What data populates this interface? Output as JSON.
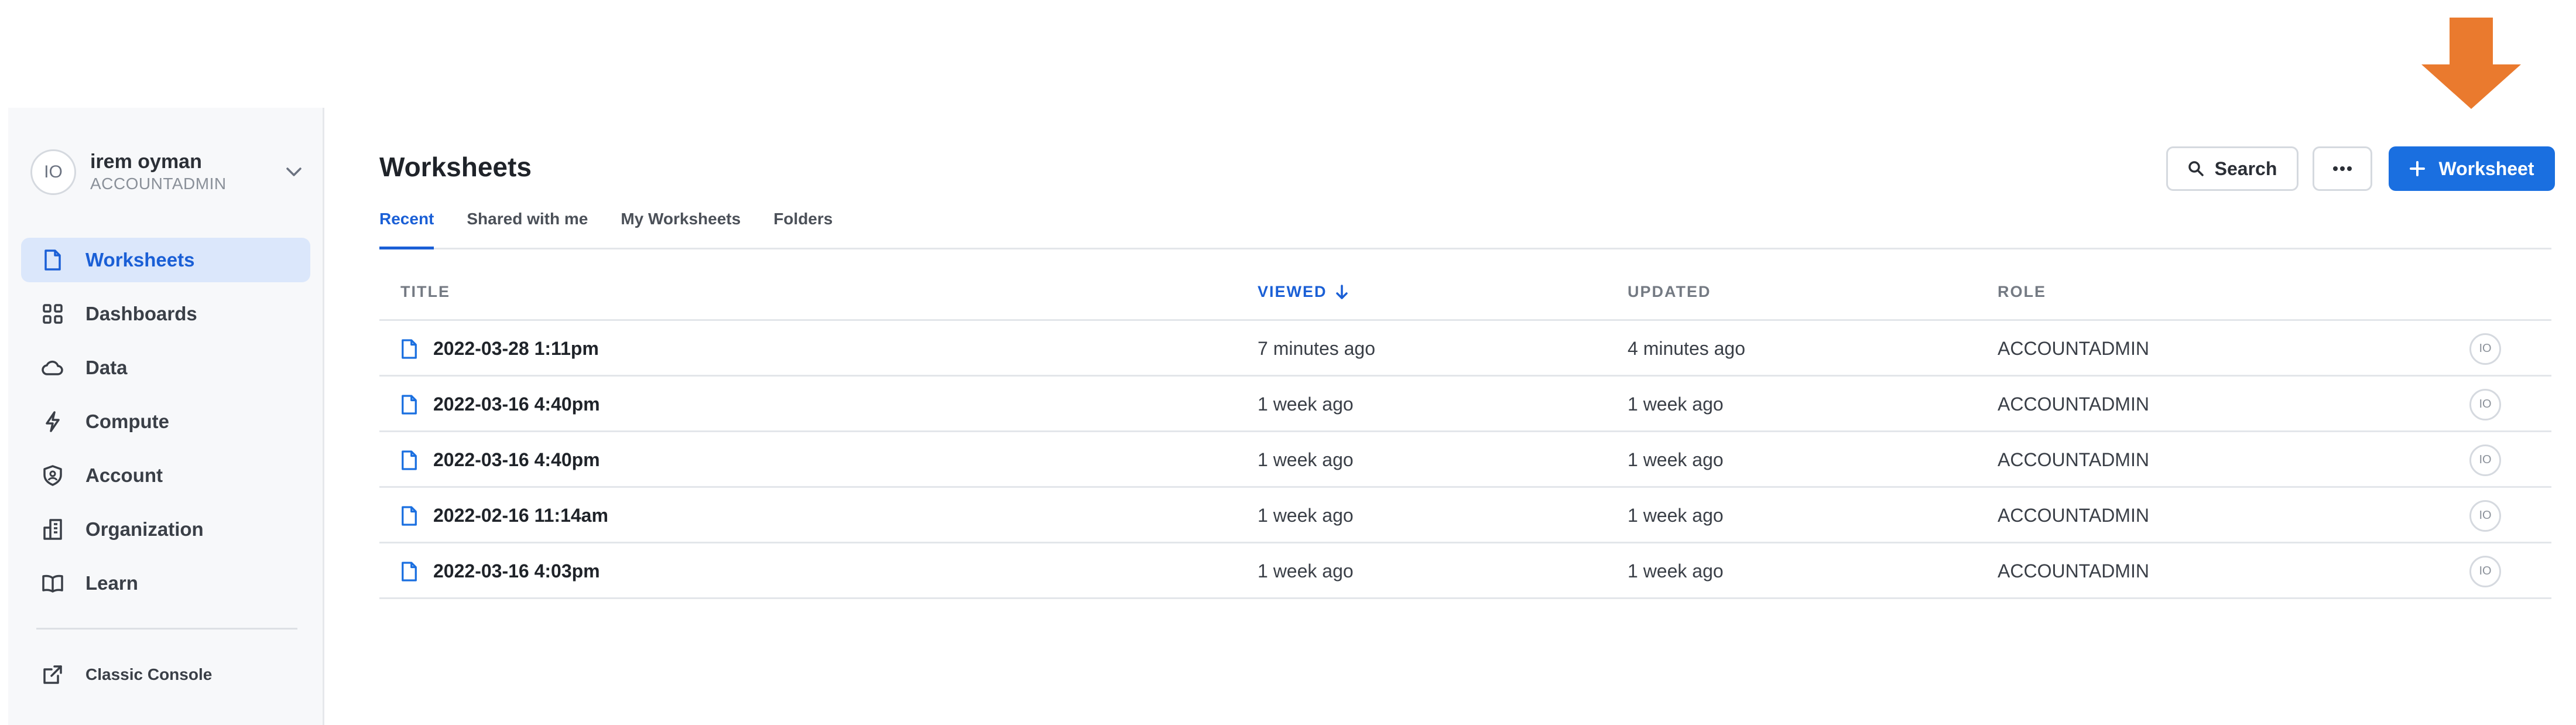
{
  "user": {
    "initials": "IO",
    "name": "irem oyman",
    "role": "ACCOUNTADMIN"
  },
  "nav": [
    {
      "label": "Worksheets",
      "icon": "file-icon",
      "active": true
    },
    {
      "label": "Dashboards",
      "icon": "grid-icon"
    },
    {
      "label": "Data",
      "icon": "cloud-icon"
    },
    {
      "label": "Compute",
      "icon": "bolt-icon"
    },
    {
      "label": "Account",
      "icon": "shield-icon"
    },
    {
      "label": "Organization",
      "icon": "building-icon"
    },
    {
      "label": "Learn",
      "icon": "book-icon"
    }
  ],
  "classic_console": "Classic Console",
  "page": {
    "title": "Worksheets"
  },
  "tabs": [
    "Recent",
    "Shared with me",
    "My Worksheets",
    "Folders"
  ],
  "toolbar": {
    "search_label": "Search",
    "new_label": "Worksheet"
  },
  "table": {
    "headers": {
      "title": "TITLE",
      "viewed": "VIEWED",
      "updated": "UPDATED",
      "role": "ROLE"
    },
    "rows": [
      {
        "title": "2022-03-28 1:11pm",
        "viewed": "7 minutes ago",
        "updated": "4 minutes ago",
        "role": "ACCOUNTADMIN",
        "owner": "IO"
      },
      {
        "title": "2022-03-16 4:40pm",
        "viewed": "1 week ago",
        "updated": "1 week ago",
        "role": "ACCOUNTADMIN",
        "owner": "IO"
      },
      {
        "title": "2022-03-16 4:40pm",
        "viewed": "1 week ago",
        "updated": "1 week ago",
        "role": "ACCOUNTADMIN",
        "owner": "IO"
      },
      {
        "title": "2022-02-16 11:14am",
        "viewed": "1 week ago",
        "updated": "1 week ago",
        "role": "ACCOUNTADMIN",
        "owner": "IO"
      },
      {
        "title": "2022-03-16 4:03pm",
        "viewed": "1 week ago",
        "updated": "1 week ago",
        "role": "ACCOUNTADMIN",
        "owner": "IO"
      }
    ]
  },
  "colors": {
    "accent": "#1a6fe0",
    "annotation_arrow": "#ea7a2e",
    "active_nav_bg": "#dbe7fb"
  }
}
